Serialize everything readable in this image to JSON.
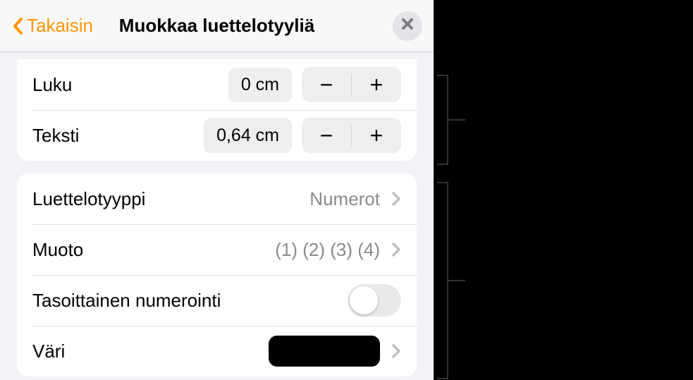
{
  "header": {
    "back_label": "Takaisin",
    "title": "Muokkaa luettelotyyliä"
  },
  "indent_section": {
    "rows": [
      {
        "label": "Luku",
        "value": "0 cm"
      },
      {
        "label": "Teksti",
        "value": "0,64 cm"
      }
    ]
  },
  "style_section": {
    "list_type_label": "Luettelotyyppi",
    "list_type_value": "Numerot",
    "format_label": "Muoto",
    "format_value": "(1) (2) (3) (4)",
    "tiered_label": "Tasoittainen numerointi",
    "tiered_on": false,
    "color_label": "Väri",
    "color_value": "#000000"
  }
}
